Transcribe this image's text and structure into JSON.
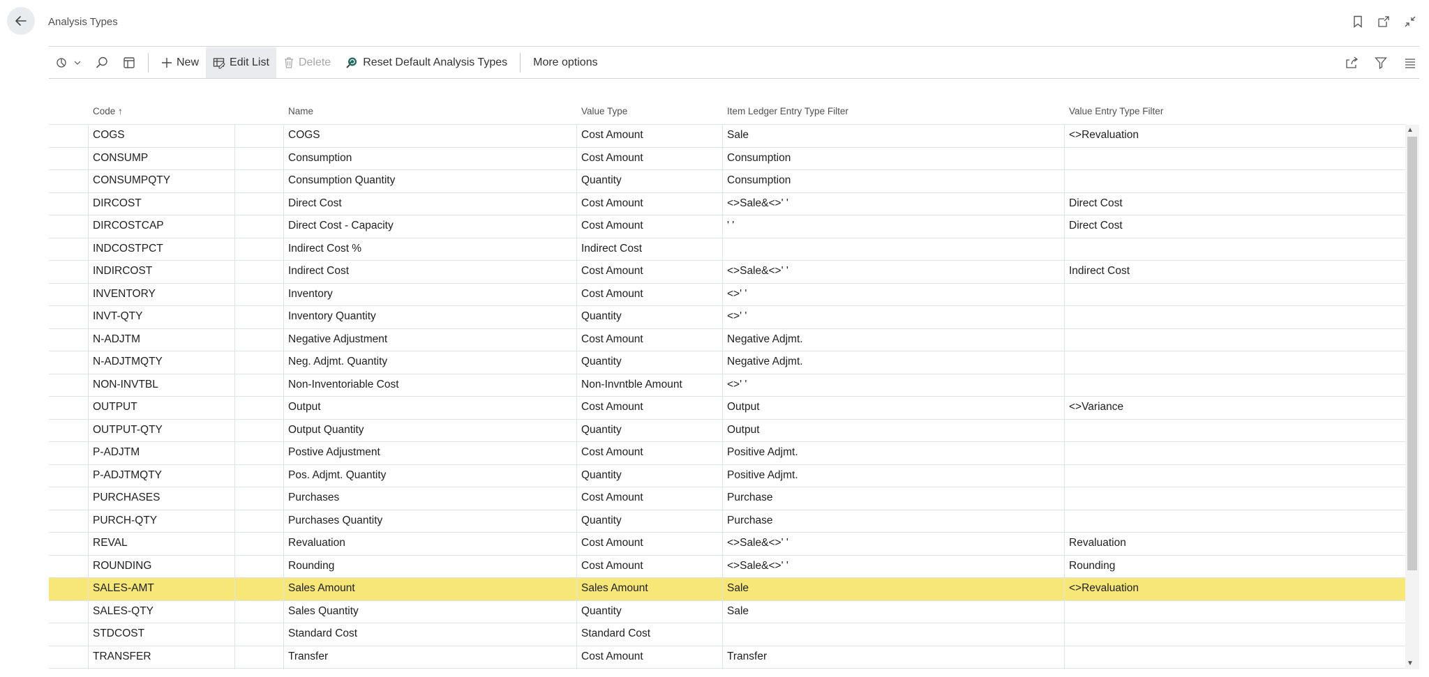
{
  "header": {
    "title": "Analysis Types"
  },
  "toolbar": {
    "new_label": "New",
    "edit_list_label": "Edit List",
    "delete_label": "Delete",
    "reset_label": "Reset Default Analysis Types",
    "more_options_label": "More options"
  },
  "table": {
    "columns": {
      "code": "Code",
      "name": "Name",
      "value_type": "Value Type",
      "item_ledger": "Item Ledger Entry Type Filter",
      "value_entry": "Value Entry Type Filter"
    },
    "sort_indicator": "↑",
    "selected_row": 20,
    "rows": [
      {
        "code": "COGS",
        "name": "COGS",
        "value_type": "Cost Amount",
        "item_ledger": "Sale",
        "value_entry": "<>Revaluation"
      },
      {
        "code": "CONSUMP",
        "name": "Consumption",
        "value_type": "Cost Amount",
        "item_ledger": "Consumption",
        "value_entry": ""
      },
      {
        "code": "CONSUMPQTY",
        "name": "Consumption Quantity",
        "value_type": "Quantity",
        "item_ledger": "Consumption",
        "value_entry": ""
      },
      {
        "code": "DIRCOST",
        "name": "Direct Cost",
        "value_type": "Cost Amount",
        "item_ledger": "<>Sale&<>' '",
        "value_entry": "Direct Cost"
      },
      {
        "code": "DIRCOSTCAP",
        "name": "Direct Cost - Capacity",
        "value_type": "Cost Amount",
        "item_ledger": "' '",
        "value_entry": "Direct Cost"
      },
      {
        "code": "INDCOSTPCT",
        "name": "Indirect Cost %",
        "value_type": "Indirect Cost",
        "item_ledger": "",
        "value_entry": ""
      },
      {
        "code": "INDIRCOST",
        "name": "Indirect Cost",
        "value_type": "Cost Amount",
        "item_ledger": "<>Sale&<>' '",
        "value_entry": "Indirect Cost"
      },
      {
        "code": "INVENTORY",
        "name": "Inventory",
        "value_type": "Cost Amount",
        "item_ledger": "<>' '",
        "value_entry": ""
      },
      {
        "code": "INVT-QTY",
        "name": "Inventory Quantity",
        "value_type": "Quantity",
        "item_ledger": "<>' '",
        "value_entry": ""
      },
      {
        "code": "N-ADJTM",
        "name": "Negative Adjustment",
        "value_type": "Cost Amount",
        "item_ledger": "Negative Adjmt.",
        "value_entry": ""
      },
      {
        "code": "N-ADJTMQTY",
        "name": "Neg. Adjmt. Quantity",
        "value_type": "Quantity",
        "item_ledger": "Negative Adjmt.",
        "value_entry": ""
      },
      {
        "code": "NON-INVTBL",
        "name": "Non-Inventoriable Cost",
        "value_type": "Non-Invntble Amount",
        "item_ledger": "<>' '",
        "value_entry": ""
      },
      {
        "code": "OUTPUT",
        "name": "Output",
        "value_type": "Cost Amount",
        "item_ledger": "Output",
        "value_entry": "<>Variance"
      },
      {
        "code": "OUTPUT-QTY",
        "name": "Output Quantity",
        "value_type": "Quantity",
        "item_ledger": "Output",
        "value_entry": ""
      },
      {
        "code": "P-ADJTM",
        "name": "Postive Adjustment",
        "value_type": "Cost Amount",
        "item_ledger": "Positive Adjmt.",
        "value_entry": ""
      },
      {
        "code": "P-ADJTMQTY",
        "name": "Pos. Adjmt. Quantity",
        "value_type": "Quantity",
        "item_ledger": "Positive Adjmt.",
        "value_entry": ""
      },
      {
        "code": "PURCHASES",
        "name": "Purchases",
        "value_type": "Cost Amount",
        "item_ledger": "Purchase",
        "value_entry": ""
      },
      {
        "code": "PURCH-QTY",
        "name": "Purchases Quantity",
        "value_type": "Quantity",
        "item_ledger": "Purchase",
        "value_entry": ""
      },
      {
        "code": "REVAL",
        "name": "Revaluation",
        "value_type": "Cost Amount",
        "item_ledger": "<>Sale&<>' '",
        "value_entry": "Revaluation"
      },
      {
        "code": "ROUNDING",
        "name": "Rounding",
        "value_type": "Cost Amount",
        "item_ledger": "<>Sale&<>' '",
        "value_entry": "Rounding"
      },
      {
        "code": "SALES-AMT",
        "name": "Sales Amount",
        "value_type": "Sales Amount",
        "item_ledger": "Sale",
        "value_entry": "<>Revaluation"
      },
      {
        "code": "SALES-QTY",
        "name": "Sales Quantity",
        "value_type": "Quantity",
        "item_ledger": "Sale",
        "value_entry": ""
      },
      {
        "code": "STDCOST",
        "name": "Standard Cost",
        "value_type": "Standard Cost",
        "item_ledger": "",
        "value_entry": ""
      },
      {
        "code": "TRANSFER",
        "name": "Transfer",
        "value_type": "Cost Amount",
        "item_ledger": "Transfer",
        "value_entry": ""
      }
    ]
  }
}
